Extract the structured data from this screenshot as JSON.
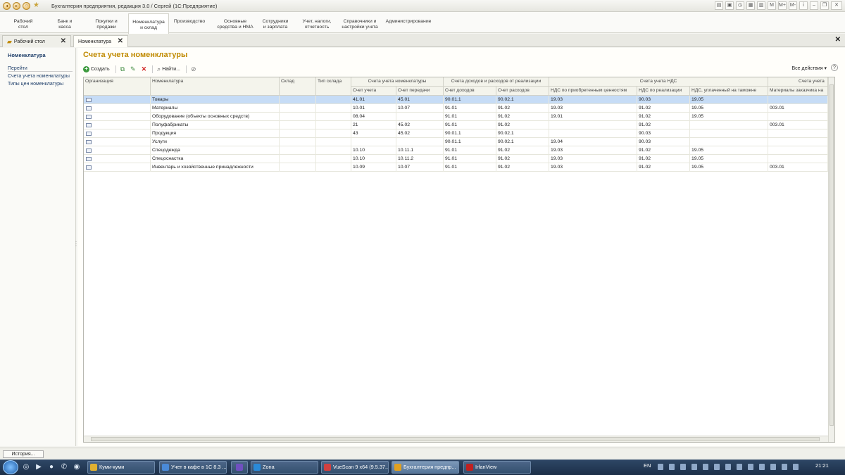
{
  "window": {
    "title": "Бухгалтерия предприятия, редакция 3.0 / Сергей  (1С:Предприятие)",
    "right_icons": [
      "M",
      "M+",
      "M-"
    ]
  },
  "sections": [
    {
      "l1": "Рабочий",
      "l2": "стол"
    },
    {
      "l1": "Банк и",
      "l2": "касса"
    },
    {
      "l1": "Покупки и",
      "l2": "продажи"
    },
    {
      "l1": "Номенклатура",
      "l2": "и склад"
    },
    {
      "l1": "Производство",
      "l2": ""
    },
    {
      "l1": "Основные",
      "l2": "средства и НМА"
    },
    {
      "l1": "Сотрудники",
      "l2": "и зарплата"
    },
    {
      "l1": "Учет, налоги,",
      "l2": "отчетность"
    },
    {
      "l1": "Справочники и",
      "l2": "настройки учета"
    },
    {
      "l1": "Администрирование",
      "l2": ""
    }
  ],
  "tabs": [
    {
      "label": "Рабочий стол"
    },
    {
      "label": "Номенклатура"
    }
  ],
  "sidebar": {
    "title": "Номенклатура",
    "section": "Перейти",
    "links": [
      "Счета учета номенклатуры",
      "Типы цен номенклатуры"
    ]
  },
  "form": {
    "title": "Счета учета номенклатуры",
    "create_label": "Создать",
    "find_label": "Найти...",
    "all_actions": "Все действия",
    "help": "?"
  },
  "table": {
    "single_headers": [
      "Организация",
      "Номенклатура",
      "Склад",
      "Тип склада"
    ],
    "group_headers": [
      "Счета учета номенклатуры",
      "Счета доходов и расходов от реализации",
      "Счета учета НДС",
      "Счета учета"
    ],
    "sub_headers": [
      "Счет учета",
      "Счет передачи",
      "Счет доходов",
      "Счет расходов",
      "НДС по приобретенным ценностям",
      "НДС по реализации",
      "НДС, уплаченный на таможне",
      "Материалы заказчика на"
    ],
    "rows": [
      {
        "item": "Товары",
        "cols": [
          "41.01",
          "45.01",
          "90.01.1",
          "90.02.1",
          "19.03",
          "90.03",
          "19.05",
          ""
        ]
      },
      {
        "item": "Материалы",
        "cols": [
          "10.01",
          "10.07",
          "91.01",
          "91.02",
          "19.03",
          "91.02",
          "19.05",
          "003.01"
        ]
      },
      {
        "item": "Оборудование (объекты основных средств)",
        "cols": [
          "08.04",
          "",
          "91.01",
          "91.02",
          "19.01",
          "91.02",
          "19.05",
          ""
        ]
      },
      {
        "item": "Полуфабрикаты",
        "cols": [
          "21",
          "45.02",
          "91.01",
          "91.02",
          "",
          "91.02",
          "",
          "003.01"
        ]
      },
      {
        "item": "Продукция",
        "cols": [
          "43",
          "45.02",
          "90.01.1",
          "90.02.1",
          "",
          "90.03",
          "",
          ""
        ]
      },
      {
        "item": "Услуги",
        "cols": [
          "",
          "",
          "90.01.1",
          "90.02.1",
          "19.04",
          "90.03",
          "",
          ""
        ]
      },
      {
        "item": "Спецодежда",
        "cols": [
          "10.10",
          "10.11.1",
          "91.01",
          "91.02",
          "19.03",
          "91.02",
          "19.05",
          ""
        ]
      },
      {
        "item": "Спецоснастка",
        "cols": [
          "10.10",
          "10.11.2",
          "91.01",
          "91.02",
          "19.03",
          "91.02",
          "19.05",
          ""
        ]
      },
      {
        "item": "Инвентарь и хозяйственные принадлежности",
        "cols": [
          "10.09",
          "10.07",
          "91.01",
          "91.02",
          "19.03",
          "91.02",
          "19.05",
          "003.01"
        ]
      }
    ]
  },
  "history_button": "История...",
  "taskbar": {
    "items": [
      {
        "label": "Куми-куми",
        "color": "#e0b030"
      },
      {
        "label": "Учет в кафе в 1С 8.3 ...",
        "color": "#4a8ad8"
      },
      {
        "label": "Zona",
        "color": "#2a8ad8"
      },
      {
        "label": "VueScan 9 x64 (9.5.37...",
        "color": "#d04040"
      },
      {
        "label": "Бухгалтерия предпр...",
        "color": "#e0a020"
      },
      {
        "label": "IrfanView",
        "color": "#c02020"
      }
    ],
    "lang": "EN",
    "time": "21:21"
  }
}
